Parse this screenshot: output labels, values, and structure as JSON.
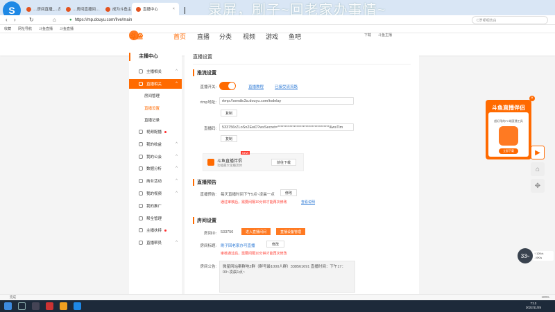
{
  "browser": {
    "tabs": [
      {
        "title": "…房间直播_…房间直播间…"
      },
      {
        "title": "…房间直播间…主播"
      },
      {
        "title": "成为斗鱼主播 - 斗鱼"
      },
      {
        "title": "直播中心"
      }
    ],
    "overlay_text": "录屏，刷子~回老家办事情~",
    "url": "https://mp.douyu.com/live/main",
    "search_placeholder": "C罗哽咽告白",
    "bookmarks": [
      "收藏",
      "网址导航",
      "斗鱼直播",
      "斗鱼直播"
    ]
  },
  "site": {
    "logo_text": "斗鱼",
    "nav": [
      "首页",
      "直播",
      "分类",
      "视频",
      "游戏",
      "鱼吧"
    ],
    "header_right": [
      "下载",
      "斗鱼主播"
    ]
  },
  "sidebar": {
    "title": "主播中心",
    "items": [
      {
        "label": "主播相关",
        "chevron": "^"
      },
      {
        "label": "直播相关",
        "chevron": "^"
      },
      {
        "label": "视频配播",
        "chevron": ""
      },
      {
        "label": "我的收益",
        "chevron": "^"
      },
      {
        "label": "我的公会",
        "chevron": "^"
      },
      {
        "label": "数据分析",
        "chevron": "^"
      },
      {
        "label": "商业活动",
        "chevron": "^"
      },
      {
        "label": "我的视频",
        "chevron": "^"
      },
      {
        "label": "我的推广",
        "chevron": ""
      },
      {
        "label": "帮全管理",
        "chevron": ""
      },
      {
        "label": "主播扶持",
        "chevron": ""
      },
      {
        "label": "直播帮员",
        "chevron": "^"
      }
    ],
    "subitems": [
      "房间管理",
      "直播设置",
      "直播记录"
    ]
  },
  "content": {
    "page_title": "直播设置",
    "stream": {
      "section_title": "推流设置",
      "toggle_label": "直播开关:",
      "link1": "直播教程",
      "link2": "已接受流流路",
      "rtmp_label": "rtmp地址:",
      "rtmp_value": "rtmp://sendtc3a.douyu.com/txdelay",
      "copy1": "复制",
      "code_label": "直播码:",
      "code_value": "533756rZLoSn2EwD?wsSecret=***********************************&wsTim",
      "copy2": "复制",
      "banner_title": "斗鱼直播伴侣",
      "banner_sub": "功能最大化播流体",
      "banner_btn": "前往下载",
      "banner_badge": "NEW"
    },
    "preview": {
      "section_title": "直播预告",
      "label": "直播预告:",
      "value": "每天直播时间下午5点~凌晨一点",
      "edit": "修改",
      "note": "通过审核后，需要间隔10分钟才能再次修改",
      "link": "查看说明"
    },
    "room": {
      "section_title": "房间设置",
      "id_label": "房间ID:",
      "id_value": "533756",
      "btn1": "进入直播间间",
      "btn2": "直播设备管理",
      "title_label": "房间标题:",
      "title_value": "刷子回老家办可直播",
      "edit": "修改",
      "note": "审核通过后，需要间隔10分钟才能再次修改",
      "notice_label": "房间公告:",
      "notice_value": "微星网站案群地2群（群号最1000人群）338561691 直播时间：下午17：00~凌晨1点~"
    }
  },
  "promo": {
    "title": "斗鱼直播伴侣",
    "desc": "超好用的PC端直播工具",
    "button": "立即下载",
    "close": "×"
  },
  "float_buttons": [
    "▶",
    "⌂",
    "✥"
  ],
  "network": {
    "badge": "33",
    "unit": "%",
    "up": "↑ 12K/s",
    "down": "↓ 0K/s"
  },
  "status": {
    "left": "完成",
    "right": "100%"
  },
  "taskbar": {
    "time": "7:13",
    "date": "2022/11/25"
  },
  "colors": {
    "brand": "#ff6a00",
    "link": "#2f7bd6",
    "warning": "#ff3b30"
  }
}
